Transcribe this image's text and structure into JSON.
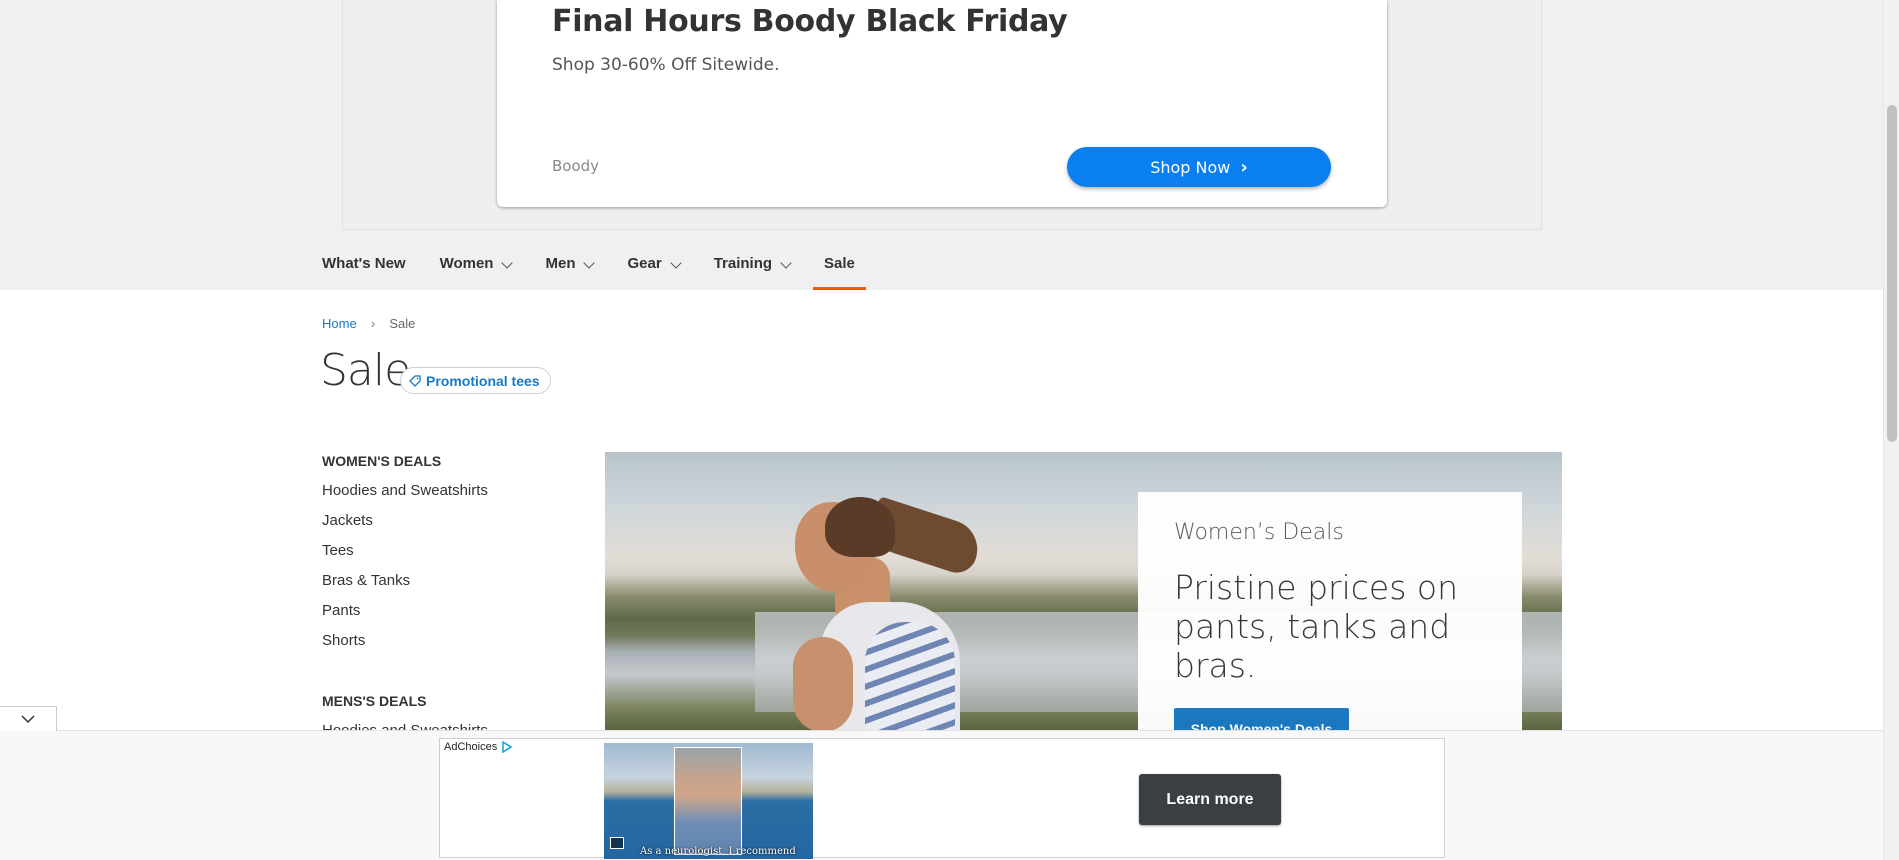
{
  "top_ad": {
    "title": "Final Hours Boody Black Friday",
    "subtitle": "Shop 30-60% Off Sitewide.",
    "brand": "Boody",
    "cta_label": "Shop Now"
  },
  "nav": {
    "items": [
      {
        "label": "What's New",
        "has_dropdown": false,
        "active": false
      },
      {
        "label": "Women",
        "has_dropdown": true,
        "active": false
      },
      {
        "label": "Men",
        "has_dropdown": true,
        "active": false
      },
      {
        "label": "Gear",
        "has_dropdown": true,
        "active": false
      },
      {
        "label": "Training",
        "has_dropdown": true,
        "active": false
      },
      {
        "label": "Sale",
        "has_dropdown": false,
        "active": true
      }
    ],
    "active_color": "#ff5501"
  },
  "breadcrumb": {
    "home": "Home",
    "current": "Sale"
  },
  "page": {
    "title": "Sale",
    "promo_tag": "Promotional tees"
  },
  "sidebar": {
    "womens": {
      "heading": "WOMEN'S DEALS",
      "links": [
        "Hoodies and Sweatshirts",
        "Jackets",
        "Tees",
        "Bras & Tanks",
        "Pants",
        "Shorts"
      ]
    },
    "mens": {
      "heading": "MENS'S DEALS",
      "links": [
        "Hoodies and Sweatshirts"
      ]
    }
  },
  "hero": {
    "eyebrow": "Women’s Deals",
    "headline": "Pristine prices on pants, tanks and bras.",
    "cta_label": "Shop Women's Deals"
  },
  "bottom_ad": {
    "adchoices_label": "AdChoices",
    "video_caption": "As a neurologist, I recommend",
    "cta_label": "Learn more"
  },
  "colors": {
    "link_blue": "#1979c3",
    "ad_button_blue": "#0a7ff0",
    "learn_more_bg": "#3b3f42"
  }
}
